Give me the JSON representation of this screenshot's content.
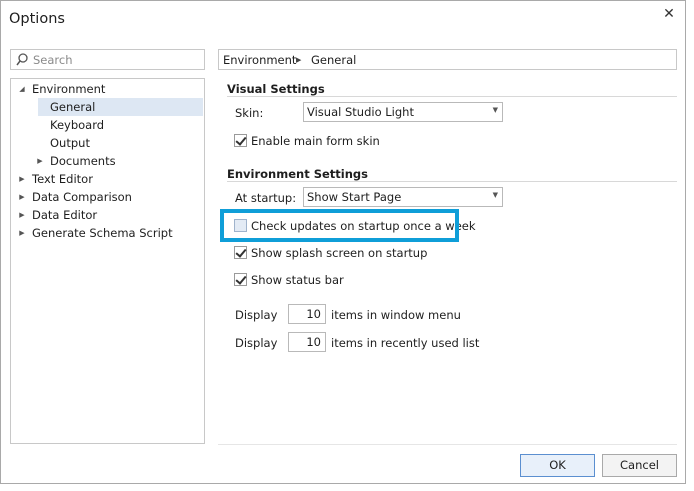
{
  "window": {
    "title": "Options",
    "close_glyph": "✕"
  },
  "search": {
    "placeholder": "Search"
  },
  "tree": {
    "items": [
      {
        "label": "Environment",
        "expanded": true
      },
      {
        "label": "General",
        "selected": true
      },
      {
        "label": "Keyboard"
      },
      {
        "label": "Output"
      },
      {
        "label": "Documents",
        "expandable": true
      },
      {
        "label": "Text Editor",
        "expandable": true
      },
      {
        "label": "Data Comparison",
        "expandable": true
      },
      {
        "label": "Data Editor",
        "expandable": true
      },
      {
        "label": "Generate Schema Script",
        "expandable": true
      }
    ]
  },
  "breadcrumb": {
    "root": "Environment",
    "current": "General"
  },
  "visual": {
    "title": "Visual Settings",
    "skin_label": "Skin:",
    "skin_value": "Visual Studio Light",
    "enable_skin_label": "Enable main form skin",
    "enable_skin_checked": true
  },
  "env": {
    "title": "Environment Settings",
    "startup_label": "At startup:",
    "startup_value": "Show Start Page",
    "check_updates_label": "Check updates on startup once a week",
    "check_updates_checked": false,
    "splash_label": "Show splash screen on startup",
    "splash_checked": true,
    "status_bar_label": "Show status bar",
    "status_bar_checked": true
  },
  "display": {
    "window_menu": {
      "prefix": "Display",
      "value": "10",
      "suffix": "items in window menu"
    },
    "recent_list": {
      "prefix": "Display",
      "value": "10",
      "suffix": "items in recently used list"
    }
  },
  "buttons": {
    "ok": "OK",
    "cancel": "Cancel"
  },
  "colors": {
    "highlight": "#0f9ed8",
    "selection": "#dde7f3"
  }
}
